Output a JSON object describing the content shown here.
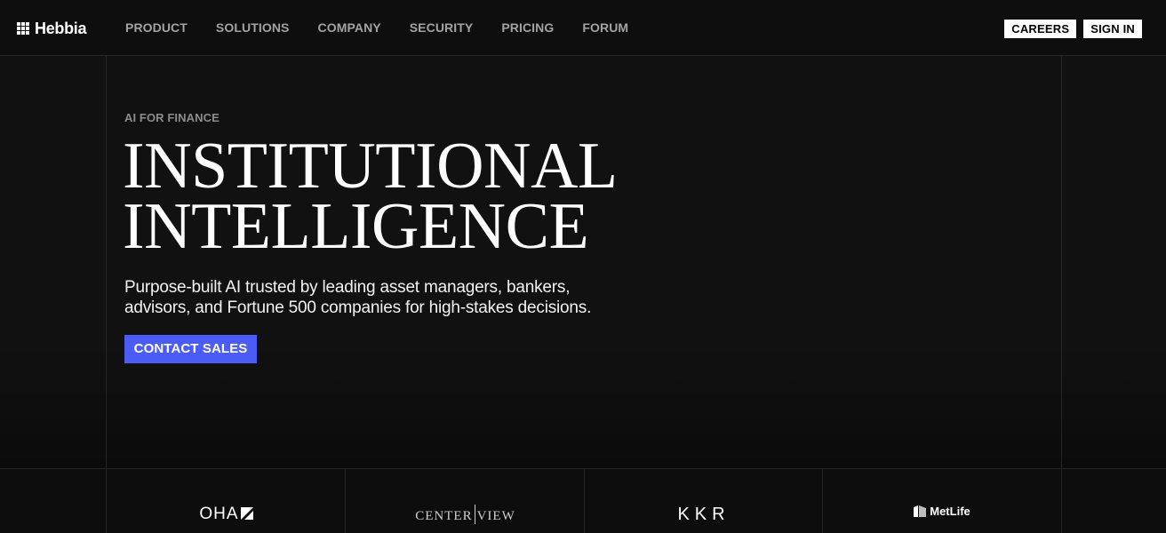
{
  "brand": {
    "name": "Hebbia",
    "icon": "grid-logo-icon"
  },
  "nav": {
    "links": [
      {
        "label": "PRODUCT"
      },
      {
        "label": "SOLUTIONS"
      },
      {
        "label": "COMPANY"
      },
      {
        "label": "SECURITY"
      },
      {
        "label": "PRICING"
      },
      {
        "label": "FORUM"
      }
    ],
    "careers_label": "CAREERS",
    "signin_label": "SIGN IN"
  },
  "hero": {
    "eyebrow": "AI FOR FINANCE",
    "headline_line1": "INSTITUTIONAL",
    "headline_line2": "INTELLIGENCE",
    "subtext_line1": "Purpose-built AI trusted by leading asset managers, bankers,",
    "subtext_line2": "advisors, and Fortune 500 companies for high-stakes decisions.",
    "cta_label": "CONTACT SALES"
  },
  "logos": [
    {
      "name": "OHA"
    },
    {
      "name_part1": "CENTER",
      "name_part2": "VIEW"
    },
    {
      "name": "KKR"
    },
    {
      "name": "MetLife"
    }
  ],
  "colors": {
    "background": "#111111",
    "nav_text": "#a3a3a3",
    "accent": "#4a5cf5",
    "border": "#262626"
  }
}
